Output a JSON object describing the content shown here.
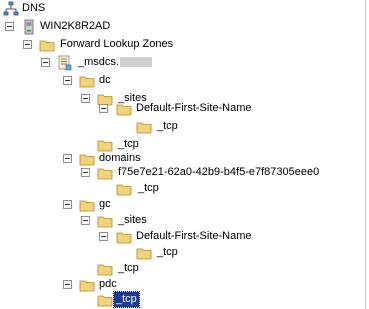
{
  "tree": {
    "root": "DNS",
    "server": "WIN2K8R2AD",
    "forward_zones": "Forward Lookup Zones",
    "msdcs_zone": "_msdcs.",
    "dc": "dc",
    "dc_sites": "_sites",
    "dc_default_site": "Default-First-Site-Name",
    "dc_site_tcp": "_tcp",
    "dc_tcp": "_tcp",
    "domains": "domains",
    "domain_guid": "f75e7e21-62a0-42b9-b4f5-e7f87305eee0",
    "domain_tcp": "_tcp",
    "gc": "gc",
    "gc_sites": "_sites",
    "gc_default_site": "Default-First-Site-Name",
    "gc_site_tcp": "_tcp",
    "gc_tcp": "_tcp",
    "pdc": "pdc",
    "pdc_tcp": "_tcp"
  },
  "selected": "pdc_tcp",
  "colors": {
    "selection": "#1f3a93",
    "folder": "#f2d27a"
  },
  "icons": {
    "root": "dns-icon",
    "server": "server-icon",
    "zone": "zone-icon",
    "folder": "folder-icon"
  }
}
